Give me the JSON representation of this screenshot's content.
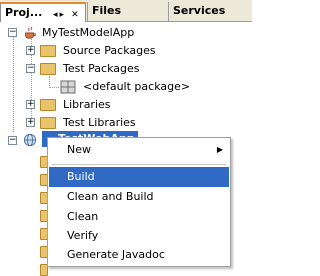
{
  "tabs": [
    {
      "label": "Proj..."
    },
    {
      "label": "Files"
    },
    {
      "label": "Services"
    }
  ],
  "tab_controls": "◂▸ ✕",
  "tree": {
    "root": "MyTestModelApp",
    "items": [
      "Source Packages",
      "Test Packages",
      "<default package>",
      "Libraries",
      "Test Libraries"
    ],
    "selected_partial": "TestWebApp"
  },
  "context_menu": {
    "items": [
      {
        "label": "New",
        "submenu": true
      },
      {
        "label": "Build",
        "highlighted": true
      },
      {
        "label": "Clean and Build"
      },
      {
        "label": "Clean"
      },
      {
        "label": "Verify"
      },
      {
        "label": "Generate Javadoc"
      }
    ]
  },
  "colors": {
    "tab_bg": "#ece9d8",
    "selection": "#316ac5",
    "folder": "#e9c46a"
  }
}
